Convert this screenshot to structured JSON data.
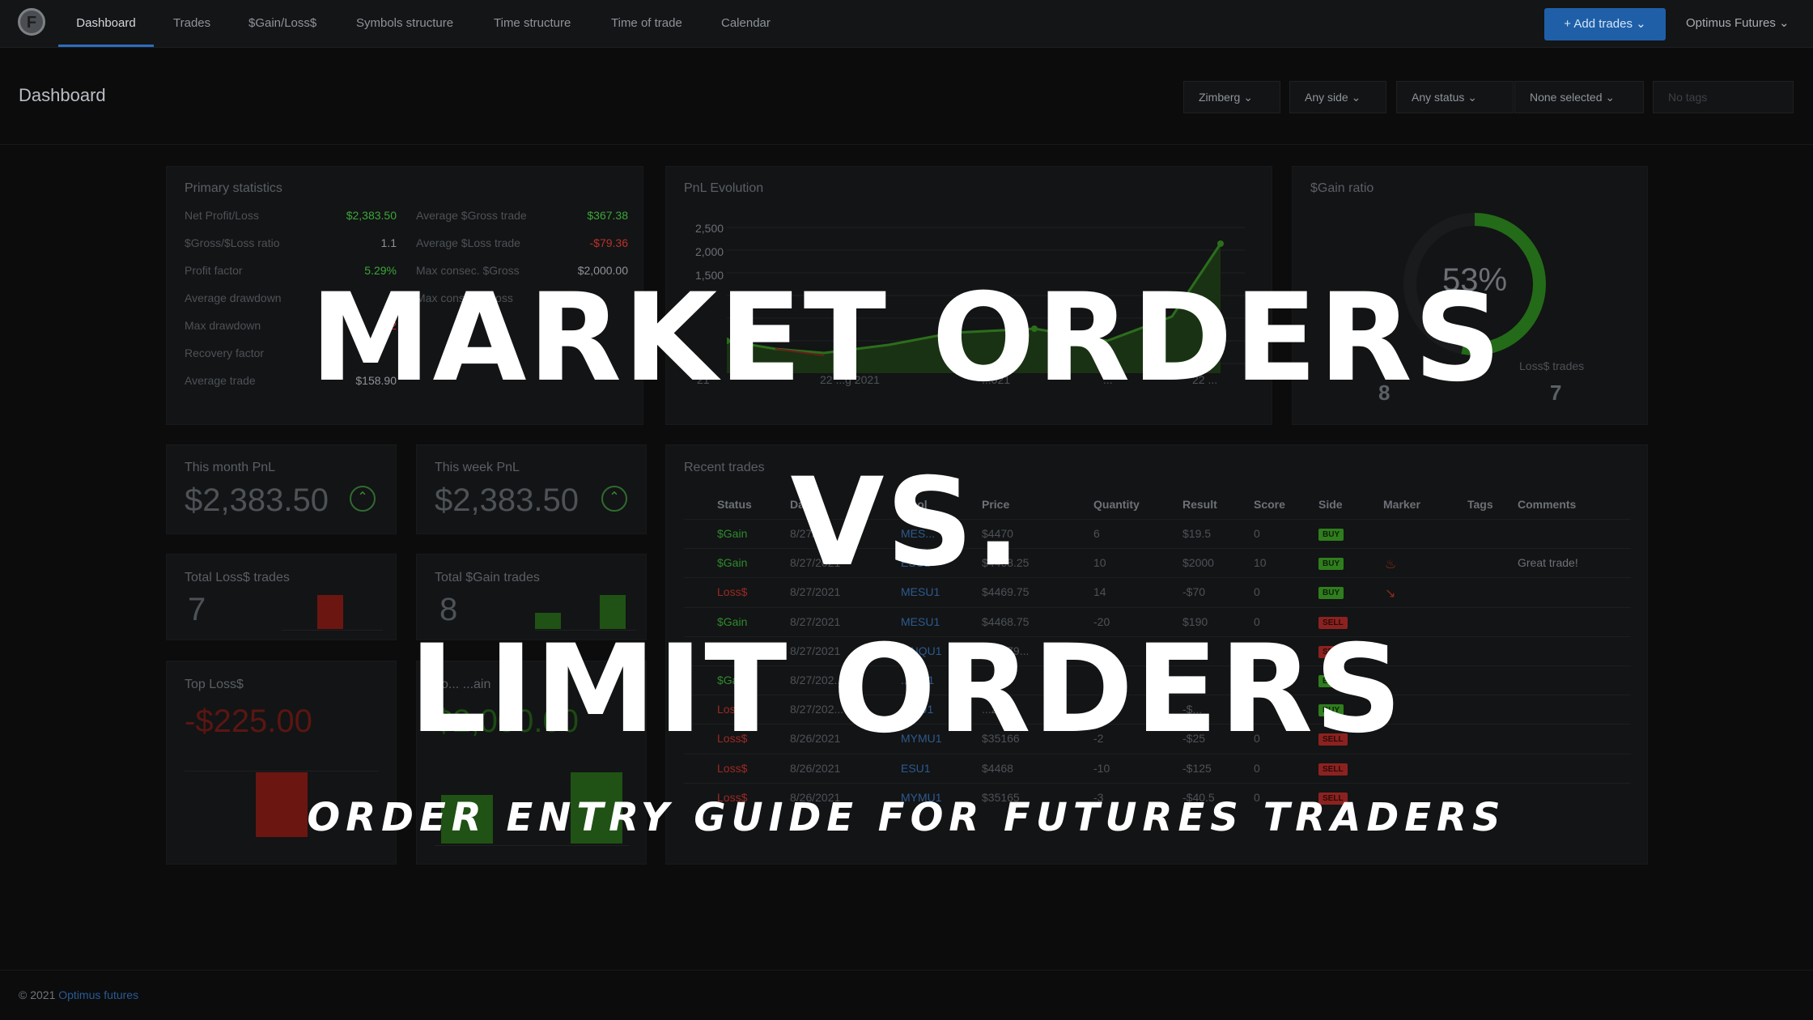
{
  "nav": {
    "items": [
      "Dashboard",
      "Trades",
      "$Gain/Loss$",
      "Symbols structure",
      "Time structure",
      "Time of trade",
      "Calendar"
    ],
    "add_trades": "+ Add trades ⌄",
    "account": "Optimus Futures ⌄",
    "logo": "F"
  },
  "header": {
    "title": "Dashboard",
    "filters": [
      "Zimberg ⌄",
      "Any side ⌄",
      "Any status ⌄",
      "None selected ⌄"
    ],
    "tags_placeholder": "No tags"
  },
  "primary": {
    "title": "Primary statistics",
    "left": [
      {
        "label": "Net Profit/Loss",
        "value": "$2,383.50",
        "color": "green"
      },
      {
        "label": "$Gross/$Loss ratio",
        "value": "1.1",
        "color": "white"
      },
      {
        "label": "Profit factor",
        "value": "5.29%",
        "color": "green"
      },
      {
        "label": "Average drawdown",
        "value": "",
        "color": "white"
      },
      {
        "label": "Max drawdown",
        "value": "-$2",
        "color": "red"
      },
      {
        "label": "Recovery factor",
        "value": "",
        "color": "white"
      },
      {
        "label": "Average trade",
        "value": "$158.90",
        "color": "white"
      }
    ],
    "right": [
      {
        "label": "Average $Gross trade",
        "value": "$367.38",
        "color": "green"
      },
      {
        "label": "Average $Loss trade",
        "value": "-$79.36",
        "color": "red"
      },
      {
        "label": "Max consec. $Gross",
        "value": "$2,000.00",
        "color": "white"
      },
      {
        "label": "Max consec. $Loss",
        "value": "",
        "color": "white"
      }
    ]
  },
  "pnl": {
    "title": "PnL Evolution",
    "yticks": [
      "2,500",
      "2,000",
      "1,500"
    ],
    "xticks": [
      "21",
      "22 ...g 2021",
      "...021",
      "...",
      "22 ..."
    ]
  },
  "gain_ratio": {
    "title": "$Gain ratio",
    "percent": "53%",
    "fraction": 0.53,
    "loss_label": "Loss$ trades",
    "gain_count": "8",
    "loss_count": "7"
  },
  "month": {
    "title": "This month PnL",
    "value": "$2,383.50"
  },
  "week": {
    "title": "This week PnL",
    "value": "$2,383.50"
  },
  "total_loss": {
    "title": "Total Loss$ trades",
    "value": "7"
  },
  "total_gain": {
    "title": "Total $Gain trades",
    "value": "8"
  },
  "top_loss": {
    "title": "Top Loss$",
    "value": "-$225.00"
  },
  "top_gain": {
    "title": "To... ...ain",
    "value": "$2,000.00"
  },
  "recent": {
    "title": "Recent trades",
    "headers": [
      "Status",
      "Da...",
      "...bol",
      "Price",
      "Quantity",
      "Result",
      "Score",
      "Side",
      "Marker",
      "Tags",
      "Comments"
    ],
    "rows": [
      {
        "status": "$Gain",
        "sc": "g",
        "date": "8/27/...",
        "sym": "MES...",
        "price": "$4470",
        "qty": "6",
        "result": "$19.5",
        "rc": "",
        "score": "0",
        "side": "BUY",
        "marker": "",
        "comment": ""
      },
      {
        "status": "$Gain",
        "sc": "g",
        "date": "8/27/2021",
        "sym": "ESU1",
        "price": "$4468.25",
        "qty": "10",
        "result": "$2000",
        "rc": "",
        "score": "10",
        "side": "BUY",
        "marker": "fire",
        "comment": "Great trade!"
      },
      {
        "status": "Loss$",
        "sc": "r",
        "date": "8/27/2021",
        "sym": "MESU1",
        "price": "$4469.75",
        "qty": "14",
        "result": "-$70",
        "rc": "",
        "score": "0",
        "side": "BUY",
        "marker": "down",
        "comment": ""
      },
      {
        "status": "$Gain",
        "sc": "g",
        "date": "8/27/2021",
        "sym": "MESU1",
        "price": "$4468.75",
        "qty": "-20",
        "result": "$190",
        "rc": "",
        "score": "0",
        "side": "SELL",
        "marker": "",
        "comment": ""
      },
      {
        "status": "$...",
        "sc": "g",
        "date": "8/27/2021",
        "sym": "MNQU1",
        "price": "$15279...",
        "qty": "-1",
        "result": "$...",
        "rc": "",
        "score": "0",
        "side": "SELL",
        "marker": "",
        "comment": ""
      },
      {
        "status": "$Gain",
        "sc": "g",
        "date": "8/27/202...",
        "sym": "...MU1",
        "price": "...91",
        "qty": "",
        "result": "$...",
        "rc": "",
        "score": "",
        "side": "BUY",
        "marker": "",
        "comment": ""
      },
      {
        "status": "Loss$",
        "sc": "r",
        "date": "8/27/202...",
        "sym": "...QU1",
        "price": "...289",
        "qty": "",
        "result": "-$...",
        "rc": "",
        "score": "",
        "side": "BUY",
        "marker": "",
        "comment": ""
      },
      {
        "status": "Loss$",
        "sc": "r",
        "date": "8/26/2021",
        "sym": "MYMU1",
        "price": "$35166",
        "qty": "-2",
        "result": "-$25",
        "rc": "",
        "score": "0",
        "side": "SELL",
        "marker": "",
        "comment": ""
      },
      {
        "status": "Loss$",
        "sc": "r",
        "date": "8/26/2021",
        "sym": "ESU1",
        "price": "$4468",
        "qty": "-10",
        "result": "-$125",
        "rc": "",
        "score": "0",
        "side": "SELL",
        "marker": "",
        "comment": ""
      },
      {
        "status": "Loss$",
        "sc": "r",
        "date": "8/26/2021",
        "sym": "MYMU1",
        "price": "$35165",
        "qty": "-3",
        "result": "-$40.5",
        "rc": "",
        "score": "0",
        "side": "SELL",
        "marker": "",
        "comment": ""
      }
    ]
  },
  "overlay": {
    "line1": "MARKET ORDERS",
    "line2": "VS.",
    "line3": "LIMIT ORDERS",
    "subtitle": "ORDER ENTRY GUIDE FOR FUTURES TRADERS"
  },
  "footer": {
    "copy": "© 2021",
    "link": "Optimus futures"
  },
  "colors": {
    "accent": "#2d6cc0",
    "gain": "#3aa63a",
    "loss": "#b8322c"
  }
}
